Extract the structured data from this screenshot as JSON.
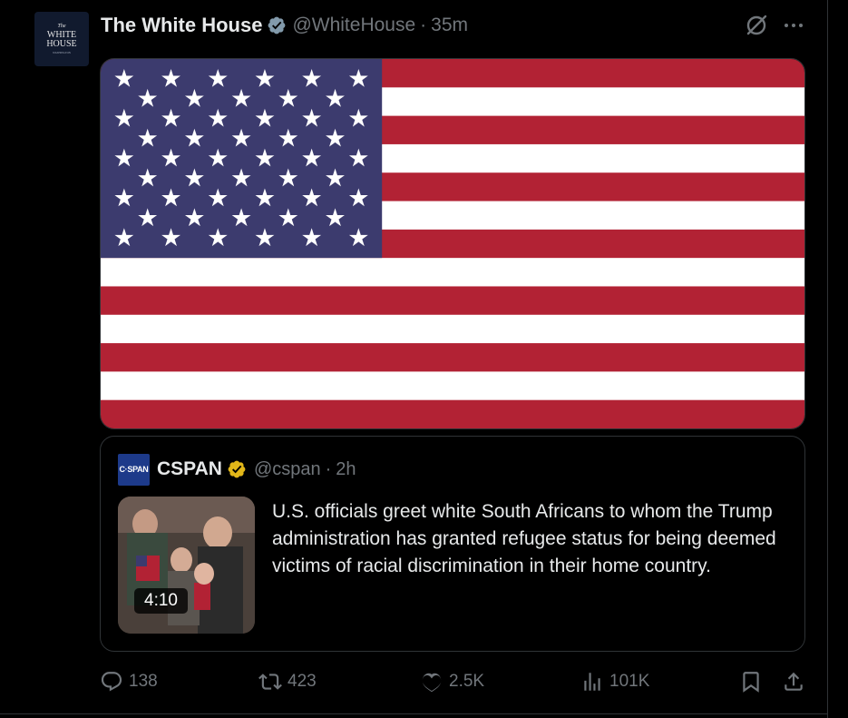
{
  "post": {
    "avatar": {
      "line1": "The",
      "line2": "WHITE",
      "line3": "HOUSE",
      "line4": "WASHINGTON"
    },
    "author": "The White House",
    "handle": "@WhiteHouse",
    "separator": "·",
    "time": "35m",
    "media": {
      "image": "united-states-flag"
    }
  },
  "quote": {
    "avatar_text": "C·SPAN",
    "author": "CSPAN",
    "handle": "@cspan",
    "separator": "·",
    "time": "2h",
    "video_duration": "4:10",
    "text": "U.S. officials greet white South Africans to whom the Trump administration has granted refugee status for being deemed victims of racial discrimination in their home country."
  },
  "actions": {
    "replies": "138",
    "reposts": "423",
    "likes": "2.5K",
    "views": "101K"
  },
  "colors": {
    "background": "#000000",
    "text": "#e7e9ea",
    "secondary": "#71767b",
    "verified_blue": "#829aab",
    "verified_gold": "#e2b719",
    "flag_red": "#b22234",
    "flag_blue": "#3c3b6e"
  }
}
